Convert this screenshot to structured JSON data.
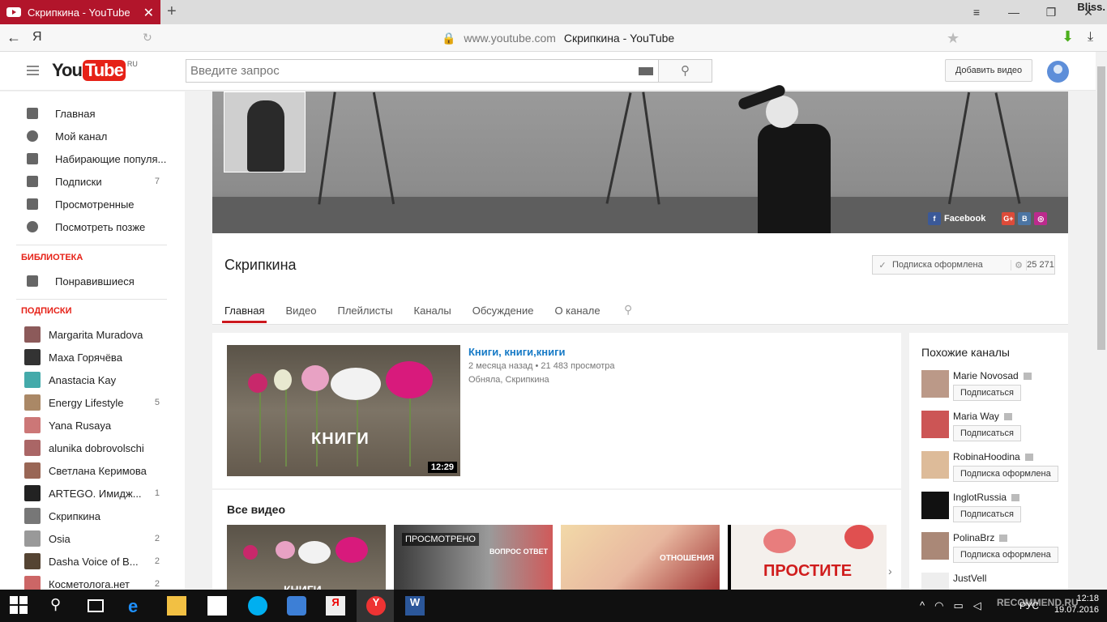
{
  "browser": {
    "tab_title": "Скрипкина - YouTube",
    "tab_close": "✕",
    "new_tab": "+",
    "user": "Bliss.",
    "yandex_btn": "Я",
    "url_host": "www.youtube.com",
    "url_title": "Скрипкина - YouTube"
  },
  "header": {
    "logo_you": "You",
    "logo_tube": "Tube",
    "logo_region": "RU",
    "search_placeholder": "Введите запрос",
    "upload_label": "Добавить видео"
  },
  "guide": {
    "items": [
      {
        "label": "Главная",
        "icon": "home-icon"
      },
      {
        "label": "Мой канал",
        "icon": "person-icon"
      },
      {
        "label": "Набирающие популя...",
        "icon": "flame-icon"
      },
      {
        "label": "Подписки",
        "count": "7",
        "icon": "subscriptions-icon"
      },
      {
        "label": "Просмотренные",
        "icon": "hourglass-icon"
      },
      {
        "label": "Посмотреть позже",
        "icon": "clock-icon"
      }
    ],
    "library_title": "БИБЛИОТЕКА",
    "liked": "Понравившиеся",
    "subs_title": "ПОДПИСКИ",
    "subs": [
      {
        "label": "Margarita Muradova",
        "count": ""
      },
      {
        "label": "Маха Горячёва",
        "count": ""
      },
      {
        "label": "Anastacia Kay",
        "count": ""
      },
      {
        "label": "Energy Lifestyle",
        "count": "5"
      },
      {
        "label": "Yana Rusaya",
        "count": ""
      },
      {
        "label": "alunika dobrovolschi",
        "count": ""
      },
      {
        "label": "Светлана Керимова",
        "count": ""
      },
      {
        "label": "ARTEGO. Имидж...",
        "count": "1"
      },
      {
        "label": "Скрипкина",
        "count": ""
      },
      {
        "label": "Osia",
        "count": "2"
      },
      {
        "label": "Dasha Voice of B...",
        "count": "2"
      },
      {
        "label": "Косметолога.нет",
        "count": "2"
      }
    ]
  },
  "banner": {
    "facebook": "Facebook",
    "gplus": "G+",
    "vk": "B",
    "instagram": "◎"
  },
  "channel": {
    "name": "Скрипкина",
    "subscribed_label": "Подписка оформлена",
    "subscriber_count": "25 271",
    "tabs": [
      "Главная",
      "Видео",
      "Плейлисты",
      "Каналы",
      "Обсуждение",
      "О канале"
    ]
  },
  "featured": {
    "title": "Книги, книги,книги",
    "age": "2 месяца назад",
    "views": "21 483 просмотра",
    "description": "Обняла, Скрипкина",
    "duration": "12:29",
    "thumb_text": "КНИГИ"
  },
  "all_videos": {
    "title": "Все видео",
    "watched_label": "ПРОСМОТРЕНО",
    "v2_text": "ВОПРОС ОТВЕТ",
    "v3_text": "ОТНОШЕНИЯ",
    "v4_text": "ПРОСТИТЕ",
    "v1_text": "КНИГИ"
  },
  "related": {
    "title": "Похожие каналы",
    "channels": [
      {
        "name": "Marie Novosad",
        "button": "Подписаться"
      },
      {
        "name": "Maria Way",
        "button": "Подписаться"
      },
      {
        "name": "RobinaHoodina",
        "button": "Подписка оформлена"
      },
      {
        "name": "InglotRussia",
        "button": "Подписаться"
      },
      {
        "name": "PolinaBrz",
        "button": "Подписка оформлена"
      },
      {
        "name": "JustVell",
        "button": ""
      }
    ]
  },
  "taskbar": {
    "time": "12:18",
    "date": "19.07.2016",
    "lang": "РУС",
    "watermark": "RECOMMEND.RU"
  },
  "colors": {
    "brand": "#e62117",
    "link": "#167ac6",
    "tab_active": "#b2152b"
  }
}
